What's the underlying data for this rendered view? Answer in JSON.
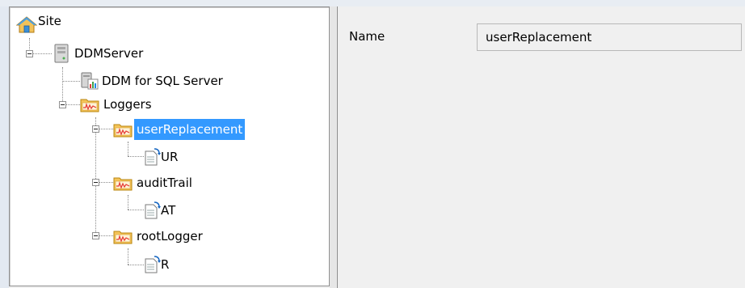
{
  "tree": {
    "root": {
      "label": "Site",
      "icon": "home-icon"
    },
    "server": {
      "label": "DDMServer",
      "icon": "server-icon"
    },
    "ddm": {
      "label": "DDM for SQL Server",
      "icon": "database-server-icon"
    },
    "loggers": {
      "label": "Loggers",
      "icon": "logger-folder-icon"
    },
    "logger_user": {
      "label": "userReplacement",
      "icon": "logger-folder-icon",
      "selected": true
    },
    "appender_ur": {
      "label": "UR",
      "icon": "appender-icon"
    },
    "logger_audit": {
      "label": "auditTrail",
      "icon": "logger-folder-icon"
    },
    "appender_at": {
      "label": "AT",
      "icon": "appender-icon"
    },
    "logger_root": {
      "label": "rootLogger",
      "icon": "logger-folder-icon"
    },
    "appender_r": {
      "label": "R",
      "icon": "appender-icon"
    }
  },
  "properties": {
    "name_label": "Name",
    "name_value": "userReplacement"
  },
  "colors": {
    "selection": "#3399ff",
    "panel_background": "#f0f0f0"
  }
}
